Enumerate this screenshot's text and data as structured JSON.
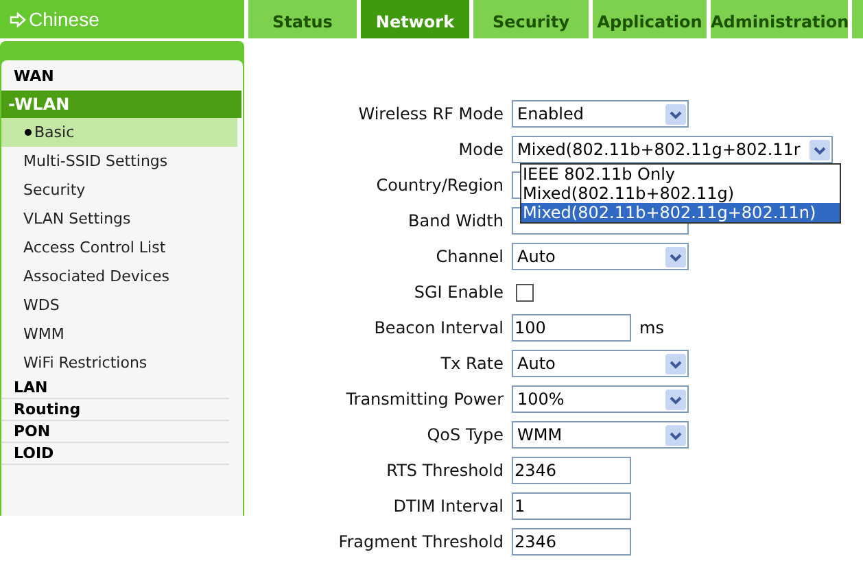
{
  "language_link": {
    "label": "Chinese"
  },
  "tabs": [
    {
      "label": "Status",
      "selected": false
    },
    {
      "label": "Network",
      "selected": true
    },
    {
      "label": "Security",
      "selected": false
    },
    {
      "label": "Application",
      "selected": false
    },
    {
      "label": "Administration",
      "selected": false
    }
  ],
  "sidebar": {
    "items": [
      {
        "label": "WAN",
        "expanded": false
      },
      {
        "label": "-WLAN",
        "expanded": true,
        "children": [
          {
            "label": "Basic",
            "selected": true
          },
          {
            "label": "Multi-SSID Settings",
            "selected": false
          },
          {
            "label": "Security",
            "selected": false
          },
          {
            "label": "VLAN Settings",
            "selected": false
          },
          {
            "label": "Access Control List",
            "selected": false
          },
          {
            "label": "Associated Devices",
            "selected": false
          },
          {
            "label": "WDS",
            "selected": false
          },
          {
            "label": "WMM",
            "selected": false
          },
          {
            "label": "WiFi Restrictions",
            "selected": false
          }
        ]
      },
      {
        "label": "LAN",
        "expanded": false
      },
      {
        "label": "Routing",
        "expanded": false
      },
      {
        "label": "PON",
        "expanded": false
      },
      {
        "label": "LOID",
        "expanded": false
      }
    ]
  },
  "form": [
    {
      "label": "Wireless RF Mode",
      "kind": "select",
      "value": "Enabled"
    },
    {
      "label": "Mode",
      "kind": "select",
      "value": "Mixed(802.11b+802.11g+802.11r",
      "open": true,
      "options": [
        {
          "label": "IEEE 802.11b Only",
          "selected": false
        },
        {
          "label": "Mixed(802.11b+802.11g)",
          "selected": false
        },
        {
          "label": "Mixed(802.11b+802.11g+802.11n)",
          "selected": true
        }
      ]
    },
    {
      "label": "Country/Region",
      "kind": "select"
    },
    {
      "label": "Band Width",
      "kind": "select"
    },
    {
      "label": "Channel",
      "kind": "select",
      "value": "Auto"
    },
    {
      "label": "SGI Enable",
      "kind": "checkbox",
      "checked": false
    },
    {
      "label": "Beacon Interval",
      "kind": "text",
      "value": "100",
      "unit": "ms"
    },
    {
      "label": "Tx Rate",
      "kind": "select",
      "value": "Auto"
    },
    {
      "label": "Transmitting Power",
      "kind": "select",
      "value": "100%"
    },
    {
      "label": "QoS Type",
      "kind": "select",
      "value": "WMM"
    },
    {
      "label": "RTS Threshold",
      "kind": "text",
      "value": "2346"
    },
    {
      "label": "DTIM Interval",
      "kind": "text",
      "value": "1"
    },
    {
      "label": "Fragment Threshold",
      "kind": "text",
      "value": "2346"
    }
  ]
}
